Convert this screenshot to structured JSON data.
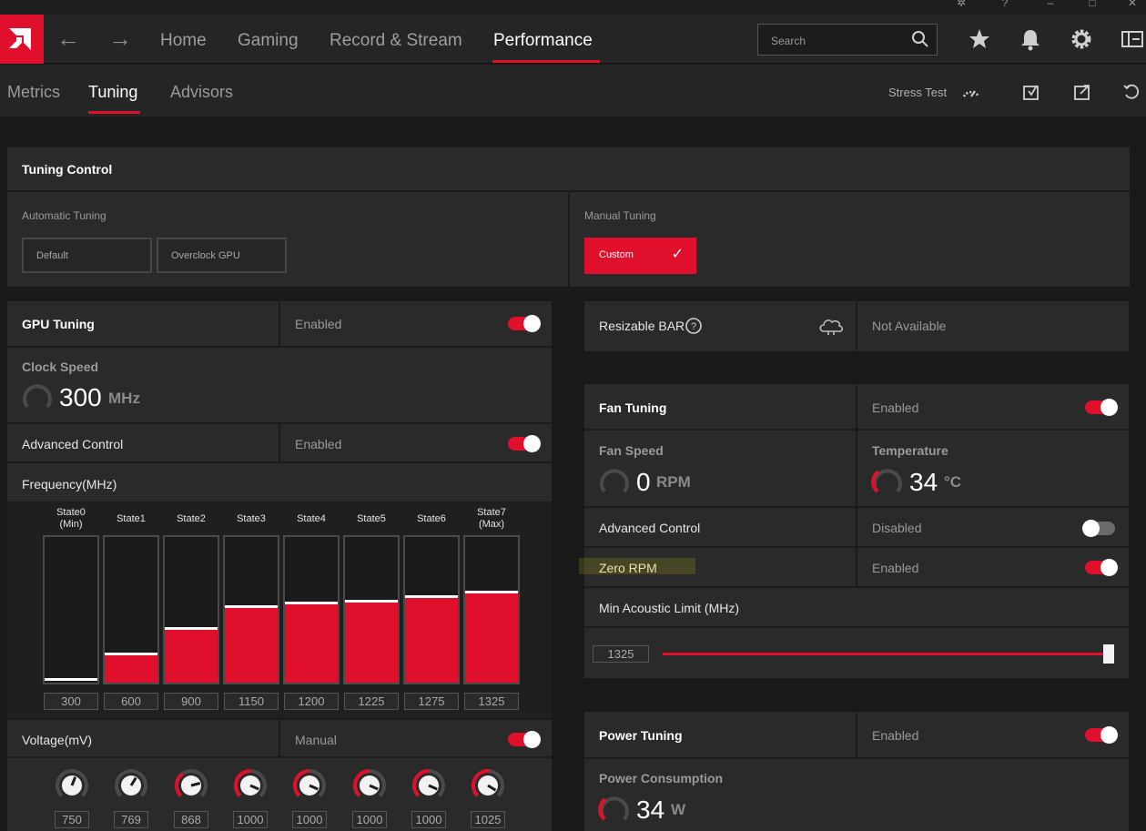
{
  "nav": {
    "home": "Home",
    "gaming": "Gaming",
    "record": "Record & Stream",
    "performance": "Performance",
    "search_placeholder": "Search"
  },
  "subnav": {
    "metrics": "Metrics",
    "tuning": "Tuning",
    "advisors": "Advisors",
    "stress_test": "Stress Test"
  },
  "tuning_control": {
    "title": "Tuning Control",
    "automatic_label": "Automatic Tuning",
    "default_btn": "Default",
    "overclock_btn": "Overclock GPU",
    "manual_label": "Manual Tuning",
    "custom_btn": "Custom"
  },
  "gpu_tuning": {
    "title": "GPU Tuning",
    "status": "Enabled",
    "enabled": true,
    "clock_speed_label": "Clock Speed",
    "clock_speed_value": "300",
    "clock_speed_unit": "MHz",
    "advanced_control_label": "Advanced Control",
    "advanced_control_status": "Enabled",
    "advanced_control_enabled": true,
    "frequency_label": "Frequency(MHz)",
    "states": [
      {
        "label": "State0",
        "sub": "(Min)",
        "value": "300",
        "level": 0.0
      },
      {
        "label": "State1",
        "sub": "",
        "value": "600",
        "level": 0.19
      },
      {
        "label": "State2",
        "sub": "",
        "value": "900",
        "level": 0.36
      },
      {
        "label": "State3",
        "sub": "",
        "value": "1150",
        "level": 0.51
      },
      {
        "label": "State4",
        "sub": "",
        "value": "1200",
        "level": 0.54
      },
      {
        "label": "State5",
        "sub": "",
        "value": "1225",
        "level": 0.55
      },
      {
        "label": "State6",
        "sub": "",
        "value": "1275",
        "level": 0.58
      },
      {
        "label": "State7",
        "sub": "(Max)",
        "value": "1325",
        "level": 0.61
      }
    ],
    "voltage_label": "Voltage(mV)",
    "voltage_status": "Manual",
    "voltage_enabled": true,
    "voltages": [
      {
        "value": "750",
        "level": 0.58
      },
      {
        "value": "769",
        "level": 0.62
      },
      {
        "value": "868",
        "level": 0.78
      },
      {
        "value": "1000",
        "level": 0.92
      },
      {
        "value": "1000",
        "level": 0.92
      },
      {
        "value": "1000",
        "level": 0.92
      },
      {
        "value": "1000",
        "level": 0.92
      },
      {
        "value": "1025",
        "level": 0.95
      }
    ]
  },
  "resizable_bar": {
    "label": "Resizable BAR",
    "status": "Not Available"
  },
  "fan_tuning": {
    "title": "Fan Tuning",
    "status": "Enabled",
    "enabled": true,
    "fan_speed_label": "Fan Speed",
    "fan_speed_value": "0",
    "fan_speed_unit": "RPM",
    "temperature_label": "Temperature",
    "temperature_value": "34",
    "temperature_unit": "°C",
    "advanced_control_label": "Advanced Control",
    "advanced_control_status": "Disabled",
    "advanced_control_enabled": false,
    "zero_rpm_label": "Zero RPM",
    "zero_rpm_status": "Enabled",
    "zero_rpm_enabled": true,
    "min_acoustic_label": "Min Acoustic Limit (MHz)",
    "min_acoustic_value": "1325",
    "min_acoustic_level": 1.0
  },
  "power_tuning": {
    "title": "Power Tuning",
    "status": "Enabled",
    "enabled": true,
    "consumption_label": "Power Consumption",
    "consumption_value": "34",
    "consumption_unit": "W"
  },
  "colors": {
    "accent": "#e0102c",
    "panel": "#2a2a2a",
    "background": "#191919"
  }
}
